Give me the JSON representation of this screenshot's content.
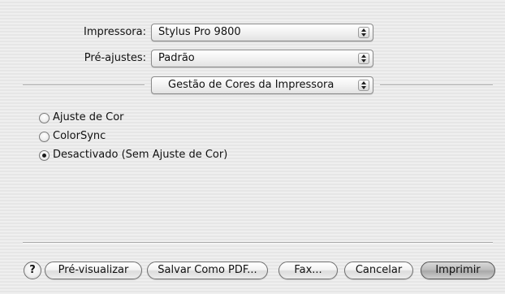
{
  "printer": {
    "label": "Impressora:",
    "value": "Stylus Pro 9800"
  },
  "presets": {
    "label": "Pré-ajustes:",
    "value": "Padrão"
  },
  "panel_selector": {
    "value": "Gestão de Cores da Impressora"
  },
  "color_options": [
    {
      "label": "Ajuste de Cor",
      "checked": false
    },
    {
      "label": "ColorSync",
      "checked": false
    },
    {
      "label": "Desactivado (Sem Ajuste de Cor)",
      "checked": true
    }
  ],
  "buttons": {
    "help": "?",
    "preview": "Pré-visualizar",
    "save_pdf": "Salvar Como PDF...",
    "fax": "Fax...",
    "cancel": "Cancelar",
    "print": "Imprimir"
  }
}
